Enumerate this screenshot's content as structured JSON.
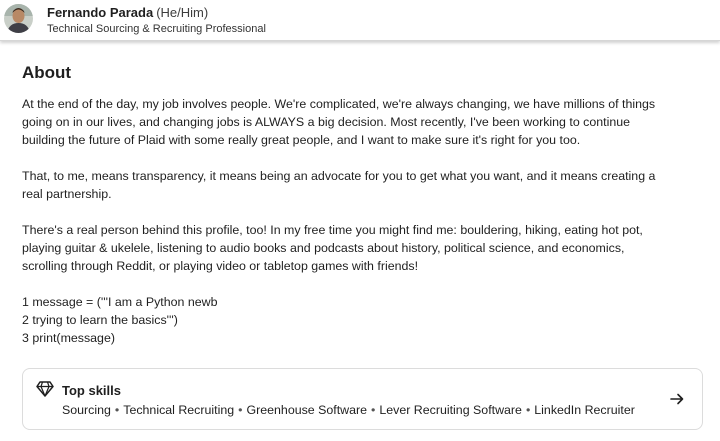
{
  "profile": {
    "name": "Fernando Parada",
    "pronouns": "(He/Him)",
    "headline": "Technical Sourcing & Recruiting Professional",
    "avatar_icon": "profile-photo"
  },
  "about": {
    "title": "About",
    "paragraph1": [
      "At the end of the day, my job involves people. We're complicated, we're always changing, we have millions of things",
      "going on in our lives, and changing jobs is ALWAYS a big decision. Most recently, I've been working to continue",
      "building the future of Plaid with some really great people, and I want to make sure it's right for you too."
    ],
    "paragraph2": [
      "That, to me, means transparency, it means being an advocate for you to get what you want, and it means creating a",
      "real partnership."
    ],
    "paragraph3": [
      "There's a real person behind this profile, too! In my free time you might find me: bouldering, hiking, eating hot pot,",
      "playing guitar & ukelele, listening to audio books and podcasts about history, political science, and economics,",
      "scrolling through Reddit, or playing video or tabletop games with friends!"
    ],
    "code_lines": [
      "1 message = ('''I am a Python newb",
      "2 trying to learn the basics''')",
      "3 print(message)"
    ]
  },
  "top_skills": {
    "title": "Top skills",
    "icon": "diamond-icon",
    "arrow_icon": "arrow-right-icon",
    "skills": [
      "Sourcing",
      "Technical Recruiting",
      "Greenhouse Software",
      "Lever Recruiting Software",
      "LinkedIn Recruiter"
    ],
    "separator": "•"
  },
  "colors": {
    "text": "#1f1f1f",
    "border": "#dcdcdc",
    "background": "#ffffff"
  }
}
